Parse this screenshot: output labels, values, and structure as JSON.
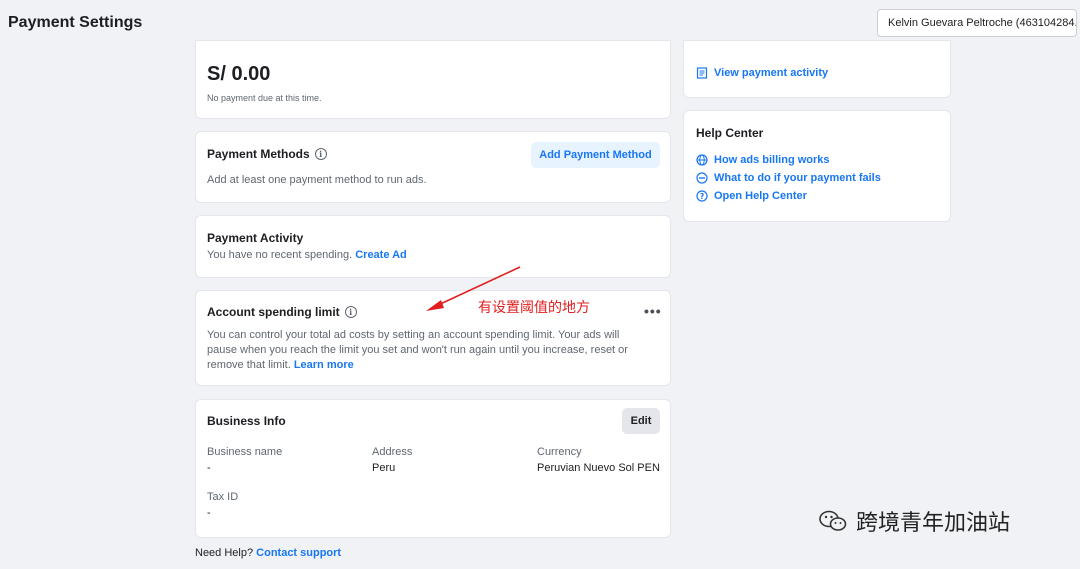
{
  "header": {
    "title": "Payment Settings",
    "account_selector": "Kelvin Guevara Peltroche (463104284..."
  },
  "balance": {
    "amount": "S/ 0.00",
    "note": "No payment due at this time."
  },
  "payment_methods": {
    "title": "Payment Methods",
    "description": "Add at least one payment method to run ads.",
    "add_button": "Add Payment Method"
  },
  "payment_activity": {
    "title": "Payment Activity",
    "description": "You have no recent spending.",
    "create_ad_link": "Create Ad"
  },
  "spending_limit": {
    "title": "Account spending limit",
    "description": "You can control your total ad costs by setting an account spending limit. Your ads will pause when you reach the limit you set and won't run again until you increase, reset or remove that limit.",
    "learn_more": "Learn more",
    "more_menu": "•••"
  },
  "business_info": {
    "title": "Business Info",
    "edit_button": "Edit",
    "fields": {
      "business_name_label": "Business name",
      "business_name_value": "-",
      "address_label": "Address",
      "address_value": "Peru",
      "currency_label": "Currency",
      "currency_value": "Peruvian Nuevo Sol PEN",
      "tax_id_label": "Tax ID",
      "tax_id_value": "-"
    }
  },
  "footer": {
    "need_help": "Need Help?",
    "contact_support": "Contact support"
  },
  "right_column": {
    "view_payment_activity": "View payment activity",
    "help_center": {
      "title": "Help Center",
      "links": [
        "How ads billing works",
        "What to do if your payment fails",
        "Open Help Center"
      ]
    }
  },
  "annotation": {
    "text": "有设置阈值的地方"
  },
  "watermark": {
    "text": "跨境青年加油站"
  },
  "colors": {
    "accent": "#1877f2",
    "annotation": "#e02020"
  }
}
